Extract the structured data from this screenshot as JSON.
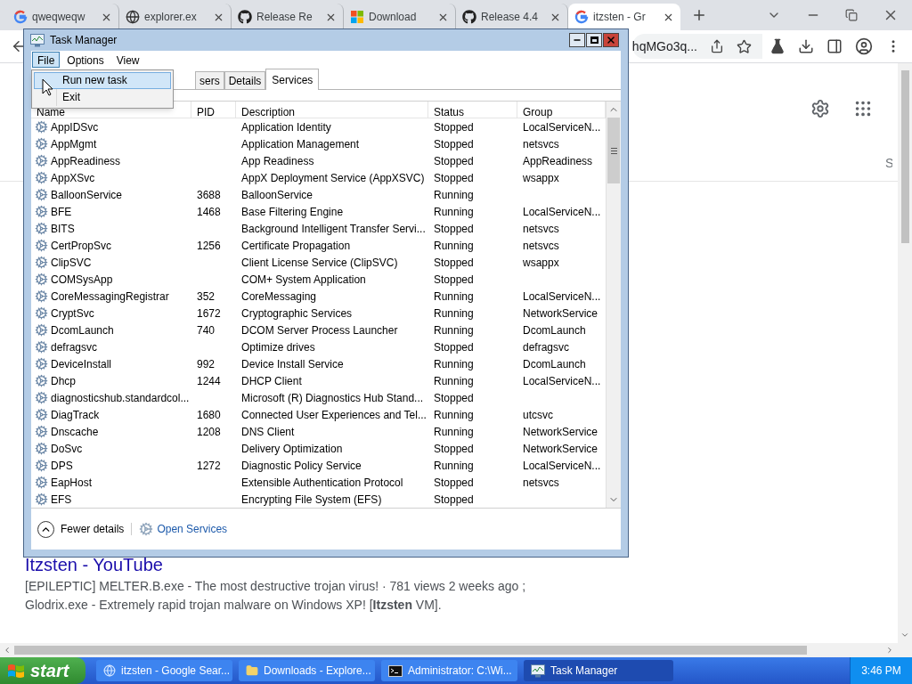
{
  "browser": {
    "tabs": [
      {
        "kind": "google",
        "title": "qweqweqw",
        "selected": false
      },
      {
        "kind": "globe",
        "title": "explorer.ex",
        "selected": false
      },
      {
        "kind": "github",
        "title": "Release Re",
        "selected": false
      },
      {
        "kind": "microsoft",
        "title": "Download",
        "selected": false
      },
      {
        "kind": "github",
        "title": "Release 4.4",
        "selected": false
      },
      {
        "kind": "google",
        "title": "itzsten - Gr",
        "selected": true
      }
    ],
    "address": "hqMGo3q...",
    "side_text": "S",
    "result": {
      "title": "Itzsten - YouTube",
      "snippet": [
        "[EPILEPTIC] MELTER.B.exe - The most destructive trojan virus! · 781 views 2 weeks ago ;",
        "Glodrix.exe - Extremely rapid trojan malware on Windows XP! [**Itzsten** VM]."
      ]
    }
  },
  "task_manager": {
    "title": "Task Manager",
    "menu": [
      {
        "label": "File",
        "selected": true
      },
      {
        "label": "Options",
        "selected": false
      },
      {
        "label": "View",
        "selected": false
      }
    ],
    "file_menu": [
      {
        "label": "Run new task",
        "selected": true
      },
      {
        "label": "Exit",
        "selected": false
      }
    ],
    "tabs": [
      {
        "label": "sers",
        "selected": false
      },
      {
        "label": "Details",
        "selected": false
      },
      {
        "label": "Services",
        "selected": true
      }
    ],
    "columns": [
      "Name",
      "PID",
      "Description",
      "Status",
      "Group"
    ],
    "rows": [
      {
        "name": "AppIDSvc",
        "description": "Application Identity",
        "status": "Stopped",
        "group": "LocalServiceN..."
      },
      {
        "name": "AppMgmt",
        "description": "Application Management",
        "status": "Stopped",
        "group": "netsvcs"
      },
      {
        "name": "AppReadiness",
        "description": "App Readiness",
        "status": "Stopped",
        "group": "AppReadiness"
      },
      {
        "name": "AppXSvc",
        "description": "AppX Deployment Service (AppXSVC)",
        "status": "Stopped",
        "group": "wsappx"
      },
      {
        "name": "BalloonService",
        "pid": "3688",
        "description": "BalloonService",
        "status": "Running"
      },
      {
        "name": "BFE",
        "pid": "1468",
        "description": "Base Filtering Engine",
        "status": "Running",
        "group": "LocalServiceN..."
      },
      {
        "name": "BITS",
        "description": "Background Intelligent Transfer Servi...",
        "status": "Stopped",
        "group": "netsvcs"
      },
      {
        "name": "CertPropSvc",
        "pid": "1256",
        "description": "Certificate Propagation",
        "status": "Running",
        "group": "netsvcs"
      },
      {
        "name": "ClipSVC",
        "description": "Client License Service (ClipSVC)",
        "status": "Stopped",
        "group": "wsappx"
      },
      {
        "name": "COMSysApp",
        "description": "COM+ System Application",
        "status": "Stopped"
      },
      {
        "name": "CoreMessagingRegistrar",
        "pid": "352",
        "description": "CoreMessaging",
        "status": "Running",
        "group": "LocalServiceN..."
      },
      {
        "name": "CryptSvc",
        "pid": "1672",
        "description": "Cryptographic Services",
        "status": "Running",
        "group": "NetworkService"
      },
      {
        "name": "DcomLaunch",
        "pid": "740",
        "description": "DCOM Server Process Launcher",
        "status": "Running",
        "group": "DcomLaunch"
      },
      {
        "name": "defragsvc",
        "description": "Optimize drives",
        "status": "Stopped",
        "group": "defragsvc"
      },
      {
        "name": "DeviceInstall",
        "pid": "992",
        "description": "Device Install Service",
        "status": "Running",
        "group": "DcomLaunch"
      },
      {
        "name": "Dhcp",
        "pid": "1244",
        "description": "DHCP Client",
        "status": "Running",
        "group": "LocalServiceN..."
      },
      {
        "name": "diagnosticshub.standardcol...",
        "description": "Microsoft (R) Diagnostics Hub Stand...",
        "status": "Stopped"
      },
      {
        "name": "DiagTrack",
        "pid": "1680",
        "description": "Connected User Experiences and Tel...",
        "status": "Running",
        "group": "utcsvc"
      },
      {
        "name": "Dnscache",
        "pid": "1208",
        "description": "DNS Client",
        "status": "Running",
        "group": "NetworkService"
      },
      {
        "name": "DoSvc",
        "description": "Delivery Optimization",
        "status": "Stopped",
        "group": "NetworkService"
      },
      {
        "name": "DPS",
        "pid": "1272",
        "description": "Diagnostic Policy Service",
        "status": "Running",
        "group": "LocalServiceN..."
      },
      {
        "name": "EapHost",
        "description": "Extensible Authentication Protocol",
        "status": "Stopped",
        "group": "netsvcs"
      },
      {
        "name": "EFS",
        "description": "Encrypting File System (EFS)",
        "status": "Stopped"
      }
    ],
    "footer": {
      "fewer_details": "Fewer details",
      "open_services": "Open Services"
    }
  },
  "taskbar": {
    "start": "start",
    "tasks": [
      {
        "kind": "chrome",
        "label": "itzsten - Google Sear...",
        "selected": false
      },
      {
        "kind": "folder",
        "label": "Downloads - Explore...",
        "selected": false
      },
      {
        "kind": "console",
        "label": "Administrator: C:\\Wi...",
        "selected": false
      },
      {
        "kind": "taskmgr",
        "label": "Task Manager",
        "selected": true
      }
    ],
    "clock": "3:46 PM"
  }
}
